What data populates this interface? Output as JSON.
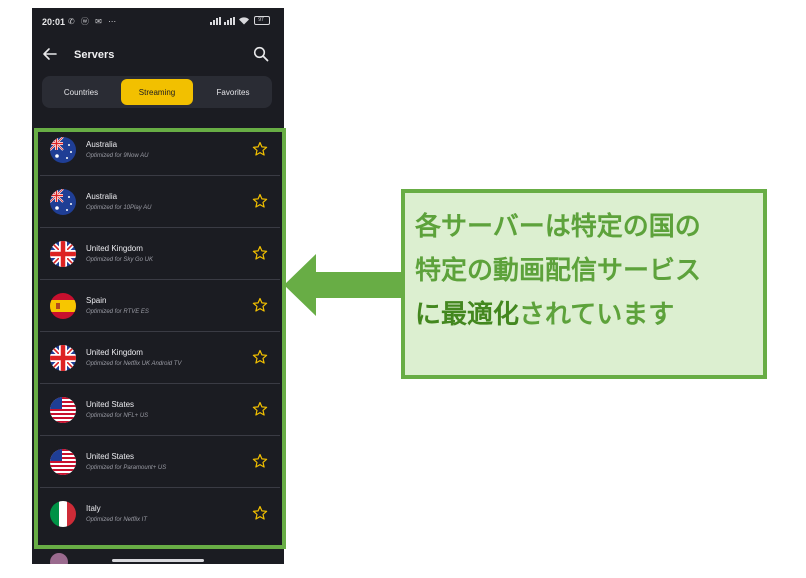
{
  "status_bar": {
    "time": "20:01",
    "left_icons": "✆ ⓦ ✉ ⋯",
    "battery": "97"
  },
  "app_bar": {
    "title": "Servers",
    "back_icon": "arrow-left-icon",
    "search_icon": "search-icon"
  },
  "tabs": [
    {
      "label": "Countries",
      "selected": false
    },
    {
      "label": "Streaming",
      "selected": true
    },
    {
      "label": "Favorites",
      "selected": false
    }
  ],
  "accent_color": "#f2c000",
  "servers": [
    {
      "country": "Australia",
      "subtitle": "Optimized for 9Now AU",
      "flag": "australia-flag"
    },
    {
      "country": "Australia",
      "subtitle": "Optimized for 10Play AU",
      "flag": "australia-flag"
    },
    {
      "country": "United Kingdom",
      "subtitle": "Optimized for Sky Go UK",
      "flag": "uk-flag"
    },
    {
      "country": "Spain",
      "subtitle": "Optimized for RTVE ES",
      "flag": "spain-flag"
    },
    {
      "country": "United Kingdom",
      "subtitle": "Optimized for Netflix UK Android TV",
      "flag": "uk-flag"
    },
    {
      "country": "United States",
      "subtitle": "Optimized for NFL+ US",
      "flag": "usa-flag"
    },
    {
      "country": "United States",
      "subtitle": "Optimized for Paramount+ US",
      "flag": "usa-flag"
    },
    {
      "country": "Italy",
      "subtitle": "Optimized for Netflix IT",
      "flag": "italy-flag"
    }
  ],
  "callout": {
    "line1": "各サーバーは特定の国の",
    "line2": "特定の動画配信サービス",
    "line3_emph": "に最適化",
    "line3_rest": "されています",
    "color": "#5da23b",
    "border_color": "#68ad45"
  }
}
